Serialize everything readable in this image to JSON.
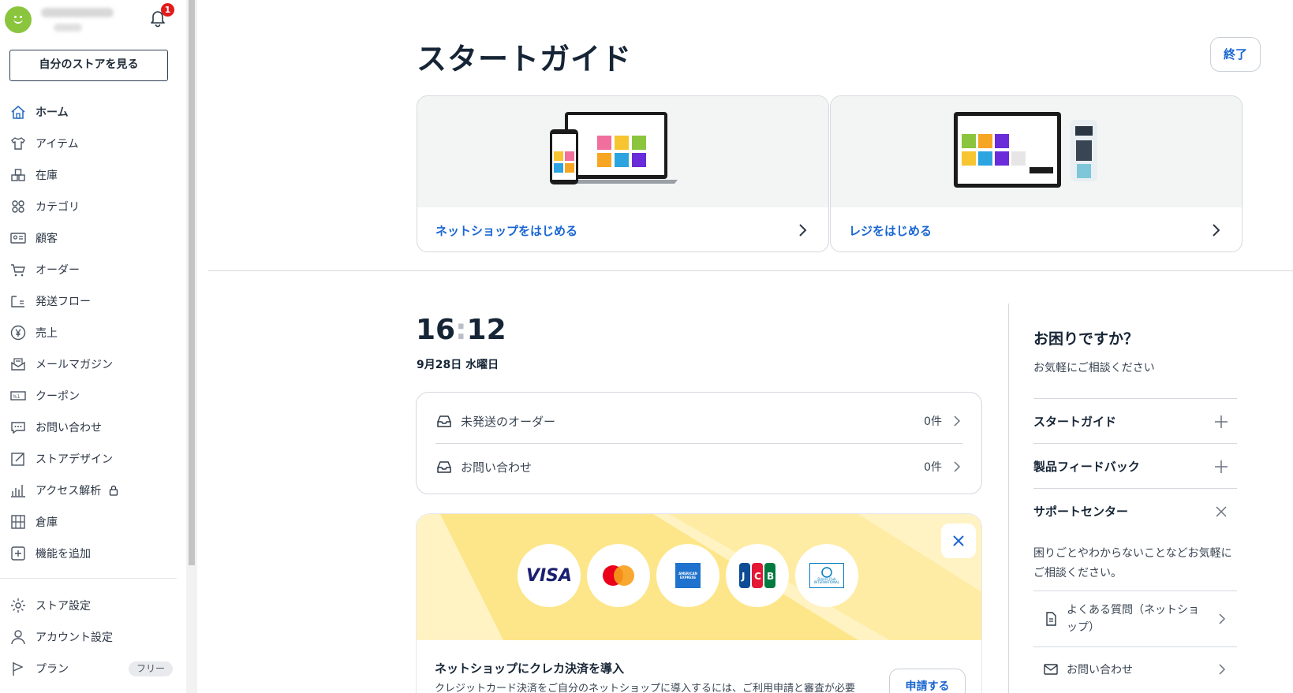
{
  "user": {
    "notification_count": "1"
  },
  "sidebar": {
    "store_button": "自分のストアを見る",
    "items": [
      {
        "label": "ホーム",
        "icon": "home-icon"
      },
      {
        "label": "アイテム",
        "icon": "shirt-icon"
      },
      {
        "label": "在庫",
        "icon": "inventory-icon"
      },
      {
        "label": "カテゴリ",
        "icon": "category-icon"
      },
      {
        "label": "顧客",
        "icon": "customer-card-icon"
      },
      {
        "label": "オーダー",
        "icon": "cart-icon"
      },
      {
        "label": "発送フロー",
        "icon": "shipping-flow-icon"
      },
      {
        "label": "売上",
        "icon": "yen-icon"
      },
      {
        "label": "メールマガジン",
        "icon": "mail-magazine-icon"
      },
      {
        "label": "クーポン",
        "icon": "coupon-icon"
      },
      {
        "label": "お問い合わせ",
        "icon": "chat-icon"
      },
      {
        "label": "ストアデザイン",
        "icon": "design-icon"
      },
      {
        "label": "アクセス解析",
        "icon": "analytics-icon"
      },
      {
        "label": "倉庫",
        "icon": "warehouse-icon"
      },
      {
        "label": "機能を追加",
        "icon": "add-icon"
      }
    ],
    "bottom_items": [
      {
        "label": "ストア設定",
        "icon": "gear-icon"
      },
      {
        "label": "アカウント設定",
        "icon": "user-icon"
      },
      {
        "label": "プラン",
        "icon": "flag-icon",
        "badge": "フリー"
      }
    ]
  },
  "guide": {
    "title": "スタートガイド",
    "end_button": "終了",
    "cards": [
      {
        "label": "ネットショップをはじめる"
      },
      {
        "label": "レジをはじめる"
      }
    ]
  },
  "dashboard": {
    "time_hour": "16",
    "time_minute": "12",
    "date": "9月28日 水曜日",
    "status": [
      {
        "label": "未発送のオーダー",
        "count": "0件"
      },
      {
        "label": "お問い合わせ",
        "count": "0件"
      }
    ]
  },
  "promo": {
    "cards": [
      "VISA",
      "Mastercard",
      "AMERICAN EXPRESS",
      "JCB",
      "Diners Club INTERNATIONAL"
    ],
    "title": "ネットショップにクレカ決済を導入",
    "desc": "クレジットカード決済をご自分のネットショップに導入するには、ご利用申請と審査が必要",
    "apply_button": "申請する"
  },
  "help": {
    "title": "お困りですか？",
    "subtitle": "お気軽にご相談ください",
    "sections": [
      "スタートガイド",
      "製品フィードバック",
      "サポートセンター"
    ],
    "support_desc": "困りごとやわからないことなどお気軽にご相談ください。",
    "links": [
      "よくある質問（ネットショップ）",
      "お問い合わせ"
    ]
  },
  "colors": {
    "accent": "#1a66d2",
    "dark": "#162536",
    "promo_yellow": "#fde68a",
    "avatar_green": "#8ac53d",
    "badge_red": "#e21b1b"
  }
}
